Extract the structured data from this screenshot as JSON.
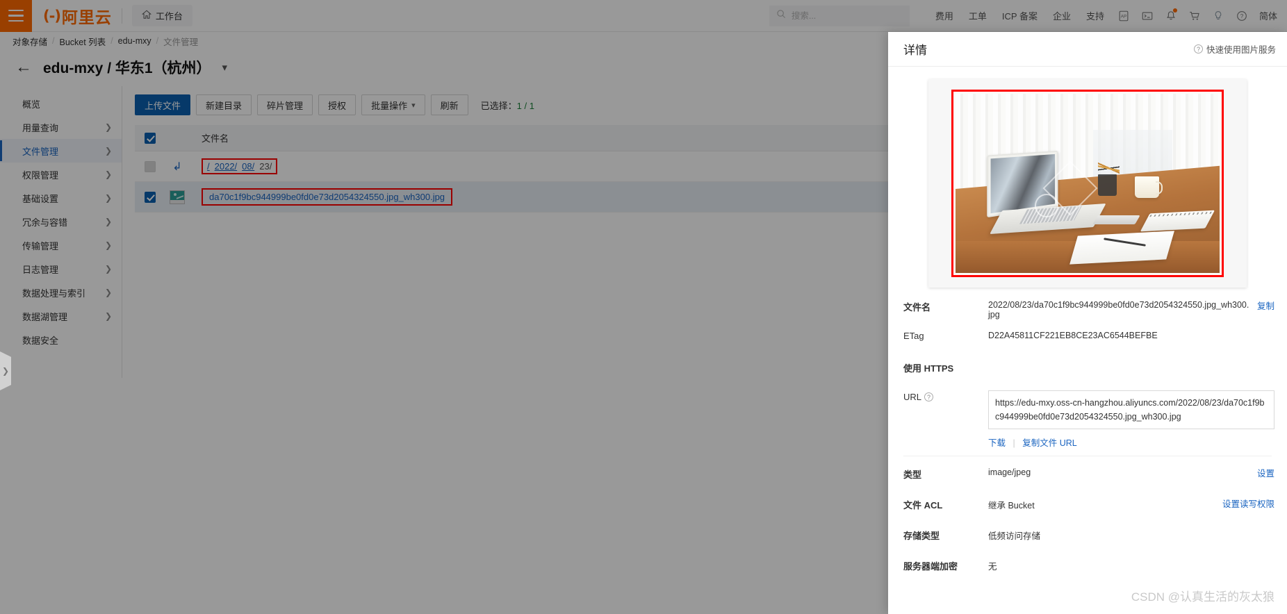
{
  "topnav": {
    "menu_icon": "hamburger-icon",
    "brand_mark": "(-)",
    "brand_text": "阿里云",
    "workbench_icon": "home-icon",
    "workbench_label": "工作台",
    "search_placeholder": "搜索...",
    "search_value": "",
    "search_icon": "search-icon",
    "links": [
      "费用",
      "工单",
      "ICP 备案",
      "企业",
      "支持"
    ],
    "icons": [
      "app-window-icon",
      "terminal-icon",
      "bell-icon",
      "cart-icon",
      "lightbulb-icon",
      "question-circle-icon"
    ],
    "lang": "简体"
  },
  "breadcrumb": {
    "items": [
      "对象存储",
      "Bucket 列表",
      "edu-mxy",
      "文件管理"
    ],
    "separator": "/"
  },
  "page": {
    "back_icon": "arrow-left-icon",
    "title": "edu-mxy / 华东1（杭州）",
    "caret_icon": "chevron-down-icon"
  },
  "sidebar": {
    "items": [
      {
        "label": "概览",
        "has_chevron": false,
        "active": false
      },
      {
        "label": "用量查询",
        "has_chevron": true,
        "active": false
      },
      {
        "label": "文件管理",
        "has_chevron": true,
        "active": true
      },
      {
        "label": "权限管理",
        "has_chevron": true,
        "active": false
      },
      {
        "label": "基础设置",
        "has_chevron": true,
        "active": false
      },
      {
        "label": "冗余与容错",
        "has_chevron": true,
        "active": false
      },
      {
        "label": "传输管理",
        "has_chevron": true,
        "active": false
      },
      {
        "label": "日志管理",
        "has_chevron": true,
        "active": false
      },
      {
        "label": "数据处理与索引",
        "has_chevron": true,
        "active": false
      },
      {
        "label": "数据湖管理",
        "has_chevron": true,
        "active": false
      },
      {
        "label": "数据安全",
        "has_chevron": false,
        "active": false
      }
    ],
    "chevron_icon": "chevron-right-icon",
    "collapse_handle_icon": "chevron-right-icon"
  },
  "toolbar": {
    "upload_label": "上传文件",
    "new_dir_label": "新建目录",
    "fragment_label": "碎片管理",
    "authorize_label": "授权",
    "batch_label": "批量操作",
    "batch_caret": "chevron-down-icon",
    "refresh_label": "刷新",
    "selected_prefix": "已选择：",
    "selected_count": "1 / 1"
  },
  "table": {
    "header_checkbox_checked": true,
    "column_name": "文件名",
    "parent_row": {
      "checkbox_checked": false,
      "back_icon": "arrow-return-icon",
      "path_parts": [
        "/",
        "2022/",
        "08/"
      ],
      "current_part": "23/"
    },
    "file_row": {
      "checkbox_checked": true,
      "thumb_icon": "image-thumbnail-icon",
      "name": "da70c1f9bc944999be0fd0e73d2054324550.jpg_wh300.jpg"
    }
  },
  "drawer": {
    "title": "详情",
    "help_icon": "question-circle-icon",
    "help_label": "快速使用图片服务",
    "preview_alt": "laptop-on-desk-photo",
    "fields": {
      "filename_label": "文件名",
      "filename_value": "2022/08/23/da70c1f9bc944999be0fd0e73d2054324550.jpg_wh300.jpg",
      "filename_action": "复制",
      "etag_label": "ETag",
      "etag_value": "D22A45811CF221EB8CE23AC6544BEFBE",
      "https_label": "使用 HTTPS",
      "https_enabled": true,
      "url_label": "URL",
      "url_value": "https://edu-mxy.oss-cn-hangzhou.aliyuncs.com/2022/08/23/da70c1f9bc944999be0fd0e73d2054324550.jpg_wh300.jpg",
      "download_label": "下载",
      "copy_url_label": "复制文件 URL",
      "type_label": "类型",
      "type_value": "image/jpeg",
      "type_action": "设置",
      "acl_label": "文件 ACL",
      "acl_value": "继承 Bucket",
      "acl_action": "设置读写权限",
      "storage_label": "存储类型",
      "storage_value": "低频访问存储",
      "encrypt_label": "服务器端加密",
      "encrypt_value": "无"
    }
  },
  "watermark": "CSDN @认真生活的灰太狼",
  "colors": {
    "brand_orange": "#ff6a00",
    "primary_blue": "#0a5fb0",
    "link_blue": "#1a64c0",
    "toggle_green": "#19b712",
    "highlight_red": "#ff0000"
  }
}
